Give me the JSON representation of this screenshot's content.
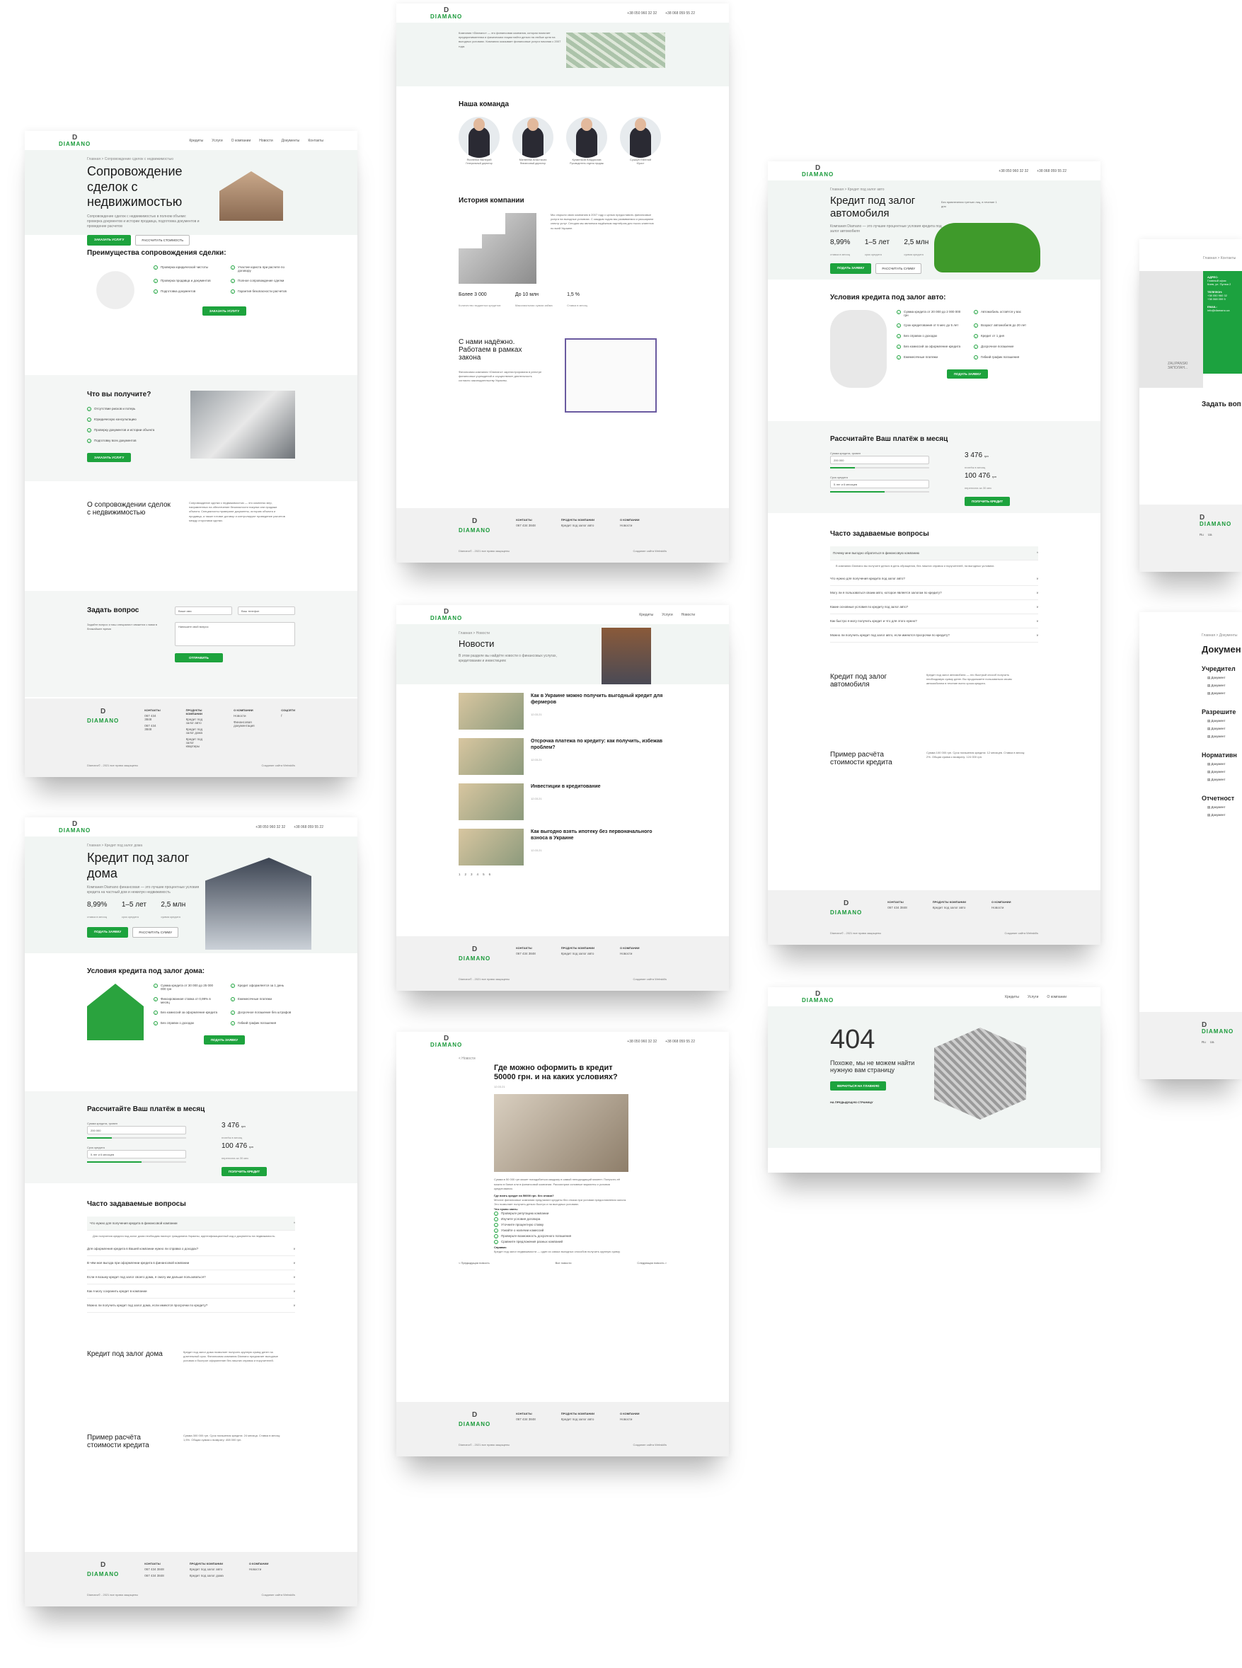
{
  "common": {
    "phone1": "+38 050 960 32 32",
    "phone2": "+38 068 059 55 22",
    "logo_word": "DIAMANO",
    "logo_mark": "D",
    "logo_sub": "финансовая компания",
    "nav": [
      "Кредиты",
      "Услуги",
      "О компании",
      "Новости",
      "Документы",
      "Контакты"
    ],
    "langs": [
      "Ru",
      "Ua",
      "En"
    ],
    "footer": {
      "contacts_title": "КОНТАКТЫ",
      "contacts": [
        "067 434 3848",
        "067 434 3848",
        "E-Mail"
      ],
      "products_title": "ПРОДУКТЫ КОМПАНИИ",
      "products": [
        "Кредит под залог авто",
        "Кредит под залог дома",
        "Кредит под залог квартиры",
        "Инвестиции",
        "Финансовый лизинг"
      ],
      "company_title": "О КОМПАНИИ",
      "company": [
        "Новости",
        "Финансовая документация",
        "Контакты"
      ],
      "social_title": "СОЦСЕТИ",
      "social": [
        "f",
        "▶"
      ],
      "copyright": "Diamano© - 2021 все права защищены",
      "made": "Создание сайта Webskills"
    }
  },
  "p1": {
    "crumb": "Главная > Сопровождение сделок с недвижимостью",
    "title": "Сопровождение сделок с недвижимостью",
    "sub": "Сопровождение сделок с недвижимостью в полном объеме: проверка документов и истории продавца, подготовка документов и проведение расчетов",
    "btn1": "ЗАКАЗАТЬ УСЛУГУ",
    "btn2": "РАССЧИТАТЬ СТОИМОСТЬ",
    "adv_title": "Преимущества сопровождения сделки:",
    "adv": [
      "Проверка юридической чистоты",
      "Участие юриста при расчете по договору",
      "Проверка продавца и документов",
      "Полное сопровождение сделки",
      "Подготовка документов",
      "Гарантия безопасности расчетов"
    ],
    "adv_btn": "ЗАКАЗАТЬ УСЛУГУ",
    "get_title": "Что вы получите?",
    "get": [
      "Отсутствие рисков и потерь",
      "Юридическую консультацию",
      "Проверку документов и истории объекта",
      "Подготовку всех документов"
    ],
    "get_btn": "ЗАКАЗАТЬ УСЛУГУ",
    "about_title": "О сопровождении сделок с недвижимостью",
    "about_text": "Сопровождение сделки с недвижимостью — это комплекс мер, направленных на обеспечение безопасности покупки или продажи объекта. Специалисты проверяют документы, историю объекта и продавца, а также готовят договор и контролируют проведение расчетов между сторонами сделки.",
    "ask_title": "Задать вопрос",
    "ask_sub": "Задайте вопрос и наш специалист свяжется с вами в ближайшее время",
    "ask_name": "Ваше имя",
    "ask_phone": "Ваш телефон",
    "ask_q": "Напишите свой вопрос",
    "ask_btn": "ОТПРАВИТЬ"
  },
  "p2": {
    "crumb": "Главная > Кредит под залог дома",
    "title": "Кредит под залог дома",
    "sub": "Компания Diamano финансовая — это лучшие процентные условия кредита на частный дом и нежилую недвижимость",
    "stats": [
      {
        "v": "8,99%",
        "l": "ставка в месяц"
      },
      {
        "v": "1–5 лет",
        "l": "срок кредита"
      },
      {
        "v": "2,5 млн",
        "l": "сумма кредита"
      }
    ],
    "btn1": "ПОДАТЬ ЗАЯВКУ",
    "btn2": "РАССЧИТАТЬ СУММУ",
    "cond_title": "Условия кредита под залог дома:",
    "cond": [
      "Сумма кредита от 30 000 до 25 000 000 грн",
      "Кредит оформляется за 1 день",
      "Фиксированная ставка от 0,99% в месяц",
      "Ежемесячные платежи",
      "Без комиссий за оформление кредита",
      "Досрочное погашение без штрафов",
      "Без справок о доходах",
      "Гибкий график погашения"
    ],
    "cond_btn": "ПОДАТЬ ЗАЯВКУ",
    "calc_title": "Рассчитайте Ваш платёж в месяц",
    "calc_sum_label": "Сумма кредита, гривен",
    "calc_sum": "200 000",
    "calc_min": "20 000",
    "calc_max": "2 000 000",
    "calc_term_label": "Срок кредита",
    "calc_term": "5 лет и 6 месяцев",
    "calc_tmin": "1 мес",
    "calc_tmax": "5 лет",
    "pay1": "3 476",
    "pay1u": "грн",
    "pay1l": "платёж в месяц",
    "pay2": "100 476",
    "pay2u": "грн",
    "pay2l": "переплата за 30 мес",
    "pay_btn": "ПОЛУЧИТЬ КРЕДИТ",
    "faq_title": "Часто задаваемые вопросы",
    "faq": [
      "Что нужно для получения кредита в финансовой компании",
      "Для оформления кредита в Вашей компании нужно ли справка о доходах?",
      "В чём моя выгода при оформлении кредита в финансовой компании",
      "Если я возьму кредит под залог своего дома, я смогу им дальше пользоваться?",
      "Как я могу сохранить кредит в компании",
      "Можно ли получить кредит под залог дома, если имеются просрочки по кредиту?"
    ],
    "faq_answer": "Для получения кредита под залог дома необходим паспорт гражданина Украины, идентификационный код и документы на недвижимость.",
    "info_title": "Кредит под залог дома",
    "info_text": "Кредит под залог дома позволяет получить крупную сумму денег на длительный срок. Финансовая компания Diamano предлагает выгодные условия и быстрое оформление без лишних справок и поручителей.",
    "ex_title": "Пример расчёта стоимости кредита",
    "ex_text": "Сумма 300 000 грн. Срок погашения кредита: 24 месяца. Ставка в месяц: 1,5%. Общая сумма к возврату: 408 000 грн."
  },
  "p3": {
    "hero_text": "Компания «Diamano» — это финансовая компания, которая помогает предпринимателям и физическим лицам найти деньги на любые цели на выгодных условиях. Компания оказывает финансовые услуги начиная с 2007 года.",
    "team_title": "Наша команда",
    "team": [
      {
        "n": "Ясиненко Валерий",
        "r": "Генеральный директор"
      },
      {
        "n": "Матвеева Анастасия",
        "r": "Финансовый директор"
      },
      {
        "n": "Кузменков Владислав",
        "r": "Руководитель отдела продаж"
      },
      {
        "n": "Сушкун Евгений",
        "r": "Юрист"
      }
    ],
    "hist_title": "История компании",
    "hist_text": "Мы открыли свою компанию в 2007 году с целью предоставить финансовые услуги на выгодных условиях. С каждым годом мы развиваемся и расширяем спектр услуг. Сегодня мы являемся надёжным партнёром для тысяч клиентов по всей Украине.",
    "stats": [
      {
        "v": "Более 3 000",
        "l": "Количество выданных кредитов"
      },
      {
        "v": "До 10 млн",
        "l": "Максимальная сумма займа"
      },
      {
        "v": "1,5 %",
        "l": "Ставка в месяц"
      }
    ],
    "trust_title": "С нами надёжно. Работаем в рамках закона",
    "trust_text": "Финансовая компания «Diamano» зарегистрирована в реестре финансовых учреждений и осуществляет деятельность согласно законодательству Украины."
  },
  "p4": {
    "crumb": "Главная > Новости",
    "title": "Новости",
    "sub": "В этом разделе вы найдёте новости о финансовых услугах, кредитовании и инвестициях",
    "items": [
      {
        "t": "Как в Украине можно получить выгодный кредит для фермеров",
        "d": "12.03.21"
      },
      {
        "t": "Отсрочка платежа по кредиту: как получить, избежав проблем?",
        "d": "12.03.21"
      },
      {
        "t": "Инвестиции в кредитование",
        "d": "12.03.21"
      },
      {
        "t": "Как выгодно взять ипотеку без первоначального взноса в Украине",
        "d": "12.03.21"
      }
    ],
    "pages": [
      "1",
      "2",
      "3",
      "4",
      "5",
      "6"
    ]
  },
  "p5": {
    "back": "< Новости",
    "title": "Где можно оформить в кредит 50000 грн. и на каких условиях?",
    "date": "12.03.21",
    "intro": "Сумма в 50 000 грн может понадобиться каждому в самый неподходящий момент. Получить её можно в банке или в финансовой компании. Рассмотрим основные варианты и условия кредитования.",
    "sub1": "Где взять кредит на 50000 грн. без отказа?",
    "text1": "Многие финансовые компании предлагают кредиты без отказа при условии предоставления залога. Это позволяет получить деньги быстро и на выгодных условиях.",
    "list_title": "Что нужно знать:",
    "list": [
      "Проверьте репутацию компании",
      "Изучите условия договора",
      "Уточните процентную ставку",
      "Узнайте о наличии комиссий",
      "Проверьте возможность досрочного погашения",
      "Сравните предложения разных компаний"
    ],
    "src_title": "Справка:",
    "src_text": "Кредит под залог недвижимости — один из самых выгодных способов получить крупную сумму.",
    "prev": "< Предыдущая новость",
    "all": "Все новости",
    "next": "Следующая новость >"
  },
  "p6": {
    "crumb": "Главная > Кредит под залог авто",
    "title": "Кредит под залог автомобиля",
    "sub": "Компания Diamano — это лучшие процентные условия кредита под залог автомобиля",
    "note": "Без привлечения третьих лиц, в течение 1 дня",
    "stats": [
      {
        "v": "8,99%",
        "l": "ставка в месяц"
      },
      {
        "v": "1–5 лет",
        "l": "срок кредита"
      },
      {
        "v": "2,5 млн",
        "l": "сумма кредита"
      }
    ],
    "btn1": "ПОДАТЬ ЗАЯВКУ",
    "btn2": "РАССЧИТАТЬ СУММУ",
    "cond_title": "Условия кредита под залог авто:",
    "cond": [
      "Сумма кредита от 20 000 до 2 000 000 грн",
      "Автомобиль остаётся у вас",
      "Срок кредитования от 6 мес до 5 лет",
      "Возраст автомобиля до 20 лет",
      "Без справок о доходах",
      "Кредит от 1 дня",
      "Без комиссий за оформление кредита",
      "Досрочное погашение",
      "Ежемесячные платежи",
      "Гибкий график погашения"
    ],
    "cond_btn": "ПОДАТЬ ЗАЯВКУ",
    "calc_title": "Рассчитайте Ваш платёж в месяц",
    "faq_title": "Часто задаваемые вопросы",
    "faq": [
      "Почему мне выгодно обратиться в финансовую компанию",
      "Что нужно для получения кредита под залог авто?",
      "Могу ли я пользоваться своим авто, которое является залогом по кредиту?",
      "Какие основные условия по кредиту под залог авто?",
      "Как быстро я могу получить кредит и что для этого нужно?",
      "Можно ли получить кредит под залог авто, если имеются просрочки по кредиту?"
    ],
    "faq_answer": "В компании Diamano вы получите деньги в день обращения, без лишних справок и поручителей, на выгодных условиях.",
    "info_title": "Кредит под залог автомобиля",
    "info_text": "Кредит под залог автомобиля — это быстрый способ получить необходимую сумму денег. Вы продолжаете пользоваться своим автомобилем в течение всего срока кредита.",
    "ex_title": "Пример расчёта стоимости кредита",
    "ex_text": "Сумма 100 000 грн. Срок погашения кредита: 12 месяцев. Ставка в месяц: 2%. Общая сумма к возврату: 124 000 грн."
  },
  "p7": {
    "code": "404",
    "msg": "Похоже, мы не можем найти нужную вам страницу",
    "btn1": "ВЕРНУТЬСЯ НА ГЛАВНУЮ",
    "btn2": "НА ПРЕДЫДУЩУЮ СТРАНИЦУ"
  },
  "p8": {
    "crumb": "Главная > Контакты",
    "map_label": "ZALIPANSKI ЗАПОЛАН...",
    "addr_title": "АДРЕС:",
    "addr": "Главный офис",
    "addr_text": "Киев, ул. Пулюя 2",
    "phones_title": "ТЕЛЕФОН:",
    "phones": [
      "+38 050 960 32",
      "+38 068 059 5"
    ],
    "email_title": "EMAIL:",
    "email": "info@diamano.ua",
    "ask_title": "Задать воп"
  },
  "p9": {
    "crumb": "Главная > Документы",
    "title": "Докумен",
    "groups": [
      {
        "t": "Учредител",
        "items": [
          "Документ",
          "Документ",
          "Документ"
        ]
      },
      {
        "t": "Разрешите",
        "items": [
          "Документ",
          "Документ",
          "Документ"
        ]
      },
      {
        "t": "Нормативн",
        "items": [
          "Документ",
          "Документ",
          "Документ"
        ]
      },
      {
        "t": "Отчетност",
        "items": [
          "Документ",
          "Документ"
        ]
      }
    ]
  },
  "colors": {
    "accent": "#1da33d",
    "hero_bg": "#f1f5f3",
    "footer_bg": "#f1f1f1"
  },
  "icons": {
    "check": "check-icon",
    "pin": "pin-icon",
    "doc": "document-icon",
    "chevron": "chevron-down-icon"
  }
}
